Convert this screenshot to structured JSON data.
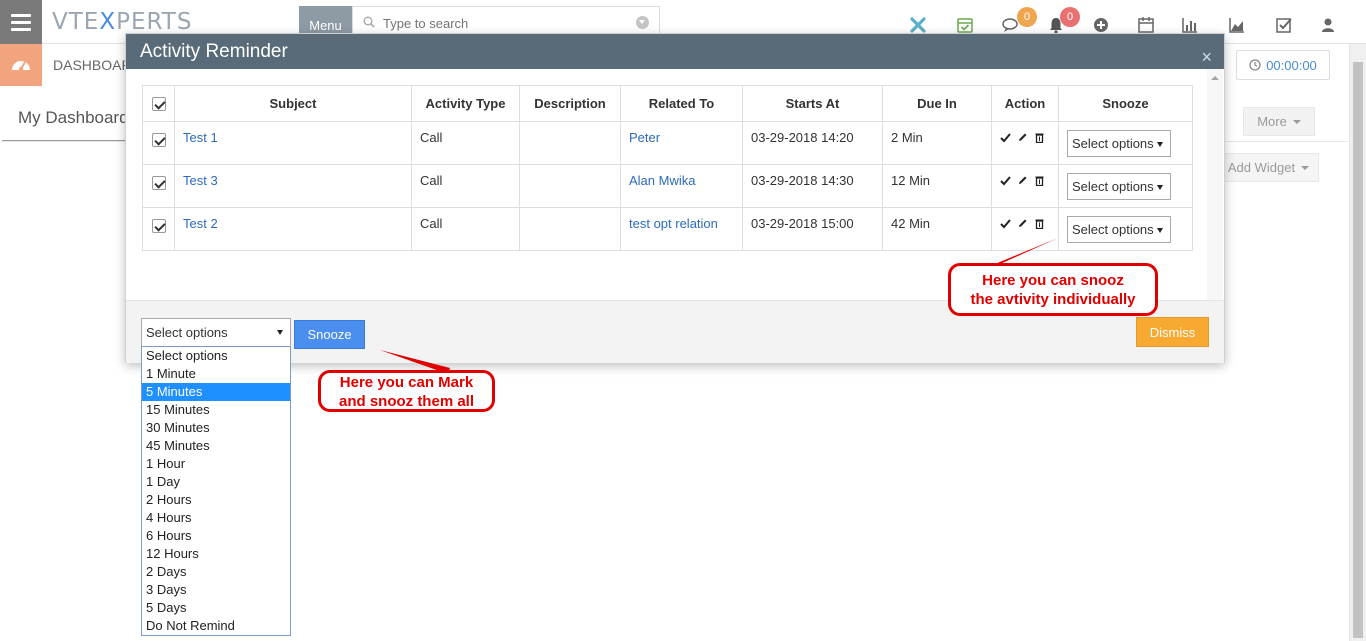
{
  "header": {
    "logo_part1": "VTE",
    "logo_part2": "X",
    "logo_part3": "PERTS",
    "menu_label": "Menu",
    "search_placeholder": "Type to search",
    "chat_badge": "0",
    "notif_badge": "0"
  },
  "subbar": {
    "dashboard_label": "DASHBOARD",
    "timer": "00:00:00",
    "my_dashboard_tab": "My Dashboard",
    "more_label": "More",
    "add_widget_label": "Add Widget"
  },
  "modal": {
    "title": "Activity Reminder",
    "close": "×",
    "columns": [
      "Subject",
      "Activity Type",
      "Description",
      "Related To",
      "Starts At",
      "Due In",
      "Action",
      "Snooze"
    ],
    "rows": [
      {
        "subject": "Test 1",
        "type": "Call",
        "description": "",
        "related": "Peter",
        "starts": "03-29-2018 14:20",
        "due": "2 Min",
        "snooze": "Select options"
      },
      {
        "subject": "Test 3",
        "type": "Call",
        "description": "",
        "related": "Alan Mwika",
        "starts": "03-29-2018 14:30",
        "due": "12 Min",
        "snooze": "Select options"
      },
      {
        "subject": "Test 2",
        "type": "Call",
        "description": "",
        "related": "test opt relation",
        "starts": "03-29-2018 15:00",
        "due": "42 Min",
        "snooze": "Select options"
      }
    ],
    "footer_select": "Select options",
    "snooze_button": "Snooze",
    "dismiss_button": "Dismiss"
  },
  "snooze_options": [
    "Select options",
    "1 Minute",
    "5 Minutes",
    "15 Minutes",
    "30 Minutes",
    "45 Minutes",
    "1 Hour",
    "1 Day",
    "2 Hours",
    "4 Hours",
    "6 Hours",
    "12 Hours",
    "2 Days",
    "3 Days",
    "5 Days",
    "Do Not Remind"
  ],
  "selected_option_index": 2,
  "annotations": {
    "individual_line1": "Here you can snooz",
    "individual_line2": "the avtivity individually",
    "all_line1": "Here you can Mark",
    "all_line2": "and snooz them all"
  },
  "colors": {
    "modal_header": "#596b78",
    "link": "#2d6bbd",
    "snooze_button": "#4a8ef0",
    "dismiss_button": "#f7a932",
    "annotation": "#e00000",
    "dashboard_icon_bg": "#f2a47e",
    "badge": "#f0a64e",
    "notif_badge": "#e97070"
  }
}
